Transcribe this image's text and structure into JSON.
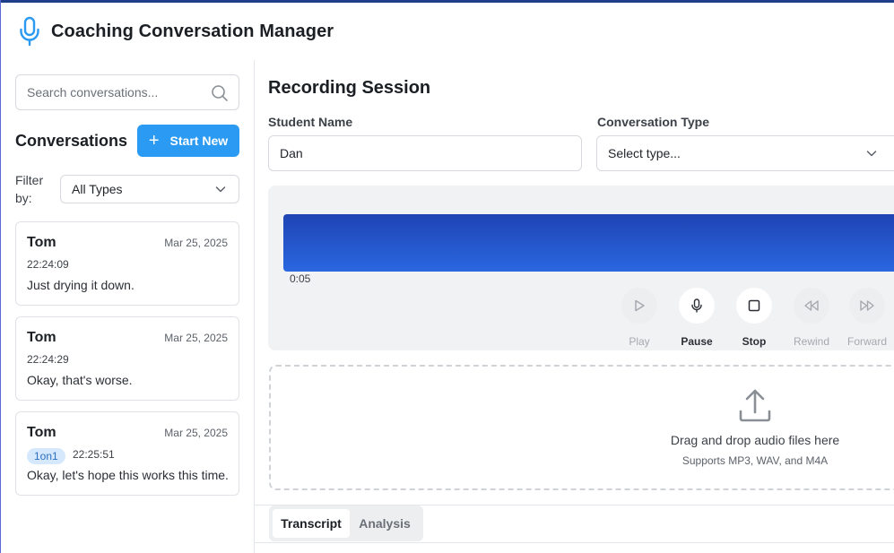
{
  "app": {
    "title": "Coaching Conversation Manager"
  },
  "sidebar": {
    "search_placeholder": "Search conversations...",
    "title": "Conversations",
    "start_new_label": "Start New",
    "filter_label": "Filter by:",
    "filter_value": "All Types",
    "conversations": [
      {
        "name": "Tom",
        "date": "Mar 25, 2025",
        "time": "22:24:09",
        "tag": "",
        "message": "Just drying it down."
      },
      {
        "name": "Tom",
        "date": "Mar 25, 2025",
        "time": "22:24:29",
        "tag": "",
        "message": "Okay, that's worse."
      },
      {
        "name": "Tom",
        "date": "Mar 25, 2025",
        "time": "22:25:51",
        "tag": "1on1",
        "message": "Okay, let's hope this works this time."
      }
    ]
  },
  "main": {
    "title": "Recording Session",
    "student_name_label": "Student Name",
    "student_name_value": "Dan",
    "conversation_type_label": "Conversation Type",
    "conversation_type_value": "Select type...",
    "player": {
      "elapsed": "0:05",
      "controls": {
        "play": "Play",
        "pause": "Pause",
        "stop": "Stop",
        "rewind": "Rewind",
        "forward": "Forward"
      }
    },
    "upload": {
      "title": "Drag and drop audio files here",
      "subtitle": "Supports MP3, WAV, and M4A"
    },
    "tabs": {
      "transcript": "Transcript",
      "analysis": "Analysis"
    }
  },
  "colors": {
    "accent": "#2b9af3",
    "waveform_top": "#1f44b4",
    "waveform_bottom": "#2a67e0",
    "tag_bg": "#d6e8fb",
    "tag_text": "#2b6fc0"
  }
}
